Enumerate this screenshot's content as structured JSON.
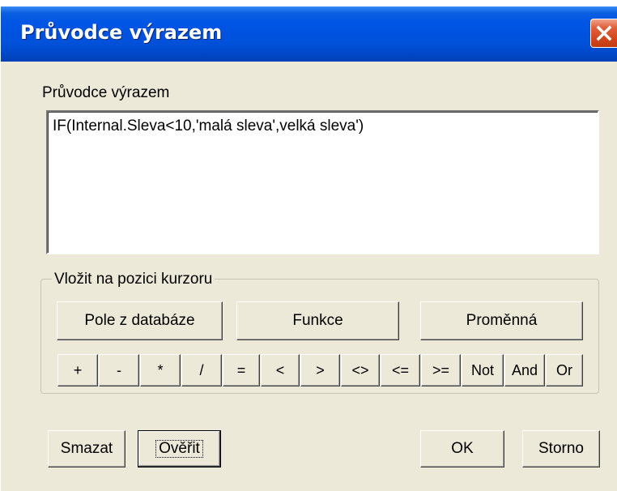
{
  "window": {
    "title": "Průvodce výrazem"
  },
  "expression": {
    "label": "Průvodce výrazem",
    "value": "IF(Internal.Sleva<10,'malá sleva',velká sleva')"
  },
  "insert_group": {
    "legend": "Vložit na pozici kurzoru",
    "buttons": {
      "field": "Pole z databáze",
      "function": "Funkce",
      "variable": "Proměnná"
    },
    "operators": [
      "+",
      "-",
      "*",
      "/",
      "=",
      "<",
      ">",
      "<>",
      "<=",
      ">=",
      "Not",
      "And",
      "Or"
    ]
  },
  "footer": {
    "clear": "Smazat",
    "verify": "Ověřit",
    "ok": "OK",
    "cancel": "Storno"
  },
  "icons": {
    "close": "close-icon"
  }
}
